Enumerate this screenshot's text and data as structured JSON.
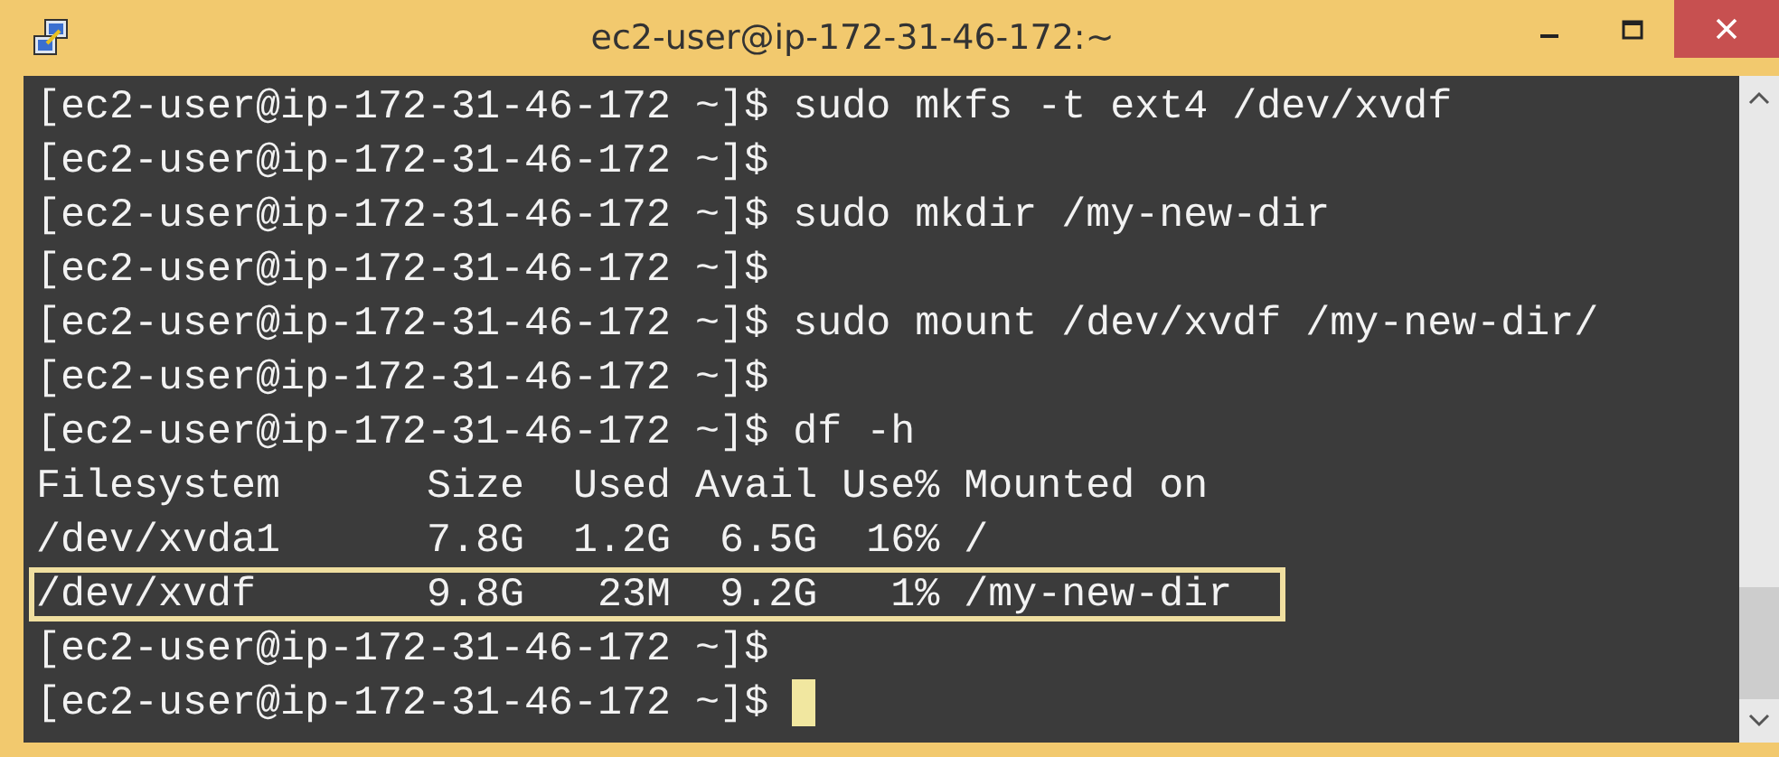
{
  "window": {
    "title": "ec2-user@ip-172-31-46-172:~"
  },
  "terminal": {
    "cursor_visible": true,
    "lines": [
      {
        "text": "[ec2-user@ip-172-31-46-172 ~]$ sudo mkfs -t ext4 /dev/xvdf",
        "highlighted": false
      },
      {
        "text": "[ec2-user@ip-172-31-46-172 ~]$",
        "highlighted": false
      },
      {
        "text": "[ec2-user@ip-172-31-46-172 ~]$ sudo mkdir /my-new-dir",
        "highlighted": false
      },
      {
        "text": "[ec2-user@ip-172-31-46-172 ~]$",
        "highlighted": false
      },
      {
        "text": "[ec2-user@ip-172-31-46-172 ~]$ sudo mount /dev/xvdf /my-new-dir/",
        "highlighted": false
      },
      {
        "text": "[ec2-user@ip-172-31-46-172 ~]$",
        "highlighted": false
      },
      {
        "text": "[ec2-user@ip-172-31-46-172 ~]$ df -h",
        "highlighted": false
      },
      {
        "text": "Filesystem      Size  Used Avail Use% Mounted on",
        "highlighted": false
      },
      {
        "text": "/dev/xvda1      7.8G  1.2G  6.5G  16% /",
        "highlighted": false
      },
      {
        "text": "/dev/xvdf       9.8G   23M  9.2G   1% /my-new-dir",
        "highlighted": true
      },
      {
        "text": "[ec2-user@ip-172-31-46-172 ~]$",
        "highlighted": false
      },
      {
        "text": "[ec2-user@ip-172-31-46-172 ~]$",
        "highlighted": false
      }
    ]
  }
}
